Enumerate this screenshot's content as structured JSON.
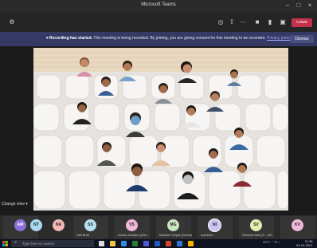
{
  "window": {
    "title": "Microsoft Teams"
  },
  "toolbar": {
    "elapsed": "",
    "leave_label": "Leave"
  },
  "banner": {
    "title": "Recording has started.",
    "message": "This meeting is being recorded. By joining, you are giving consent for this meeting to be recorded.",
    "privacy_link": "Privacy policy",
    "dismiss_label": "Dismiss"
  },
  "stage": {
    "change_view_label": "Change view"
  },
  "participants": [
    {
      "initials": "AM",
      "name": "",
      "color": "#8b6fd8"
    },
    {
      "initials": "NT",
      "name": "",
      "color": "#a8d8f0"
    },
    {
      "initials": "NA",
      "name": "",
      "color": "#f2b8b8"
    },
    {
      "initials": "SS",
      "name": "Sali Bhai",
      "color": "#b9e0f0"
    },
    {
      "initials": "VS",
      "name": "vishal vasudeo (Gue...",
      "color": "#f0b8d8"
    },
    {
      "initials": "MG",
      "name": "Madhuri Gupta (Guest)",
      "color": "#c8e6c0"
    },
    {
      "initials": "NI",
      "name": "mahesh I",
      "color": "#c9c4f0"
    },
    {
      "initials": "SV",
      "name": "Sheetal mall (G... MS",
      "color": "#e6ecb0"
    },
    {
      "initials": "KV",
      "name": "",
      "color": "#f0b8d8"
    }
  ],
  "taskbar": {
    "search_placeholder": "Type here to search",
    "tray_text": "29°C",
    "time": "11:38",
    "date": "04-10-2021"
  }
}
